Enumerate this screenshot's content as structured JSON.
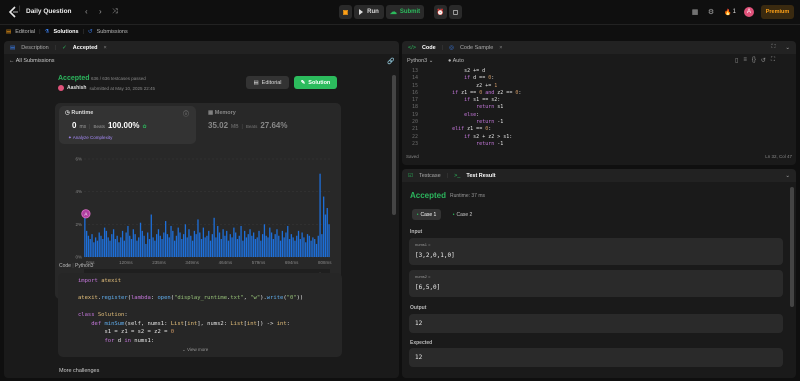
{
  "app": {
    "title": "Daily Question",
    "premium": "Premium",
    "fire_count": "1",
    "avatar_initial": "A"
  },
  "toolbar": {
    "run": "Run",
    "submit": "Submit"
  },
  "nav": {
    "editorial": "Editorial",
    "solutions": "Solutions",
    "submissions": "Submissions"
  },
  "left": {
    "tabs": [
      "Description",
      "Accepted"
    ],
    "back": "All Submissions",
    "status": "Accepted",
    "testcases": "636 / 636 testcases passed",
    "user": "Aashish",
    "submitted": "submitted at May 10, 2025 22:45",
    "editorial_btn": "Editorial",
    "solution_btn": "Solution",
    "runtime": {
      "label": "Runtime",
      "value": "0",
      "unit": "ms",
      "beats_label": "Beats",
      "beats": "100.00%",
      "analyze": "Analyze Complexity"
    },
    "memory": {
      "label": "Memory",
      "value": "35.02",
      "unit": "MB",
      "beats_label": "Beats",
      "beats": "27.64%"
    },
    "ylabels": [
      "6%",
      "4%",
      "2%",
      "0%"
    ],
    "xlabels": [
      "0ms",
      "120ms",
      "235ms",
      "349ms",
      "464ms",
      "579ms",
      "694ms",
      "808ms"
    ],
    "mini_labels": [
      "1ms",
      "120ms",
      "235ms",
      "349ms",
      "464ms",
      "579ms",
      "694ms",
      "808ms"
    ],
    "code_header": [
      "Code",
      "Python3"
    ],
    "code": [
      "import atexit",
      "",
      "atexit.register(lambda: open(\"display_runtime.txt\", \"w\").write(\"0\"))",
      "",
      "class Solution:",
      "    def minSum(self, nums1: List[int], nums2: List[int]) -> int:",
      "        s1 = z1 = s2 = z2 = 0",
      "        for d in nums1:"
    ],
    "view_more": "View more",
    "more_challenges": "More challenges"
  },
  "chart_data": {
    "type": "bar",
    "ylabel": "",
    "xlabel": "",
    "ylim": [
      0,
      6
    ],
    "x_ticks": [
      "0ms",
      "120ms",
      "235ms",
      "349ms",
      "464ms",
      "579ms",
      "694ms",
      "808ms"
    ],
    "values": [
      2.4,
      1.6,
      1.3,
      1.1,
      1.4,
      0.9,
      1.2,
      1.0,
      1.5,
      1.3,
      1.1,
      1.8,
      1.6,
      1.2,
      1.0,
      1.4,
      1.7,
      1.1,
      1.3,
      0.9,
      1.2,
      1.6,
      1.0,
      1.5,
      1.9,
      1.3,
      1.1,
      1.7,
      1.4,
      1.0,
      1.2,
      2.1,
      1.6,
      1.3,
      0.8,
      1.5,
      1.1,
      2.6,
      1.2,
      1.0,
      1.4,
      1.7,
      1.3,
      1.1,
      1.5,
      2.2,
      1.4,
      1.2,
      1.9,
      1.6,
      1.0,
      1.3,
      1.8,
      1.5,
      1.1,
      1.4,
      2.0,
      1.2,
      1.7,
      1.3,
      1.0,
      1.6,
      1.4,
      2.3,
      1.5,
      1.1,
      1.8,
      1.2,
      1.3,
      1.6,
      1.0,
      1.4,
      2.4,
      1.2,
      1.9,
      1.5,
      1.1,
      1.7,
      1.3,
      1.6,
      1.0,
      1.4,
      1.2,
      1.8,
      1.5,
      1.1,
      1.3,
      1.9,
      1.0,
      1.6,
      1.2,
      1.4,
      1.7,
      1.3,
      1.5,
      1.1,
      1.2,
      1.6,
      1.0,
      1.4,
      2.0,
      1.3,
      1.2,
      1.8,
      1.5,
      1.1,
      1.4,
      1.7,
      1.3,
      1.0,
      1.6,
      1.2,
      1.5,
      1.9,
      1.1,
      1.4,
      1.2,
      1.0,
      1.3,
      1.6,
      1.1,
      1.5,
      1.2,
      0.9,
      1.4,
      1.3,
      1.0,
      1.2,
      1.1,
      0.8,
      1.3,
      5.1,
      1.4,
      3.7,
      2.6,
      3.0,
      2.0
    ],
    "highlight_index": 0
  },
  "right": {
    "code_tabs": [
      "Code",
      "Code Sample"
    ],
    "lang": "Python3",
    "auto": "Auto",
    "line_start": 13,
    "lines": [
      "            s2 += d",
      "            if d == 0:",
      "                z2 += 1",
      "        if z1 == 0 and z2 == 0:",
      "            if s1 == s2:",
      "                return s1",
      "            else:",
      "                return -1",
      "        elif z1 == 0:",
      "            if s2 + z2 > s1:",
      "                return -1"
    ],
    "saved": "Saved",
    "cursor": "Ln 32, Col 47",
    "result_tabs": [
      "Testcase",
      "Test Result"
    ],
    "status": "Accepted",
    "runtime": "Runtime: 37 ms",
    "cases": [
      "Case 1",
      "Case 2"
    ],
    "input_label": "Input",
    "nums1_label": "nums1 =",
    "nums1": "[3,2,0,1,0]",
    "nums2_label": "nums2 =",
    "nums2": "[6,5,0]",
    "output_label": "Output",
    "output": "12",
    "expected_label": "Expected",
    "expected": "12"
  },
  "colors": {
    "accent": "#2cbb5d",
    "bar": "#1e6fd9",
    "premium": "#ffa116"
  }
}
